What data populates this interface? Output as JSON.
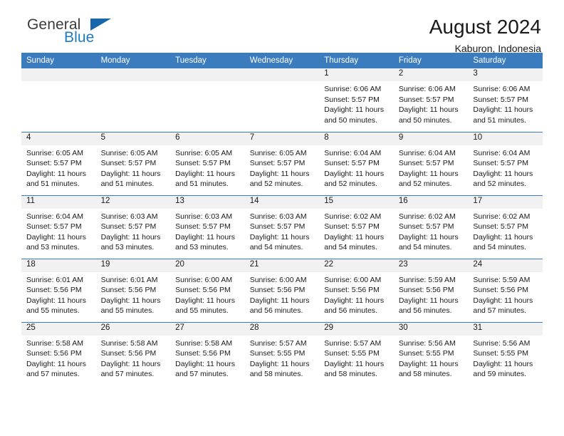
{
  "brand": {
    "name_part1": "General",
    "name_part2": "Blue",
    "flag_icon": "triangle-logo-icon"
  },
  "header": {
    "title": "August 2024",
    "location": "Kaburon, Indonesia"
  },
  "colors": {
    "header_blue": "#3a7cbe",
    "brand_blue": "#1f7bc1",
    "flag_blue": "#1866ab",
    "daynum_band": "#f1f1f1",
    "text": "#1a1a1a"
  },
  "calendar": {
    "weekday_headers": [
      "Sunday",
      "Monday",
      "Tuesday",
      "Wednesday",
      "Thursday",
      "Friday",
      "Saturday"
    ],
    "weeks": [
      [
        {
          "day": "",
          "lines": []
        },
        {
          "day": "",
          "lines": []
        },
        {
          "day": "",
          "lines": []
        },
        {
          "day": "",
          "lines": []
        },
        {
          "day": "1",
          "lines": [
            "Sunrise: 6:06 AM",
            "Sunset: 5:57 PM",
            "Daylight: 11 hours",
            "and 50 minutes."
          ]
        },
        {
          "day": "2",
          "lines": [
            "Sunrise: 6:06 AM",
            "Sunset: 5:57 PM",
            "Daylight: 11 hours",
            "and 50 minutes."
          ]
        },
        {
          "day": "3",
          "lines": [
            "Sunrise: 6:06 AM",
            "Sunset: 5:57 PM",
            "Daylight: 11 hours",
            "and 51 minutes."
          ]
        }
      ],
      [
        {
          "day": "4",
          "lines": [
            "Sunrise: 6:05 AM",
            "Sunset: 5:57 PM",
            "Daylight: 11 hours",
            "and 51 minutes."
          ]
        },
        {
          "day": "5",
          "lines": [
            "Sunrise: 6:05 AM",
            "Sunset: 5:57 PM",
            "Daylight: 11 hours",
            "and 51 minutes."
          ]
        },
        {
          "day": "6",
          "lines": [
            "Sunrise: 6:05 AM",
            "Sunset: 5:57 PM",
            "Daylight: 11 hours",
            "and 51 minutes."
          ]
        },
        {
          "day": "7",
          "lines": [
            "Sunrise: 6:05 AM",
            "Sunset: 5:57 PM",
            "Daylight: 11 hours",
            "and 52 minutes."
          ]
        },
        {
          "day": "8",
          "lines": [
            "Sunrise: 6:04 AM",
            "Sunset: 5:57 PM",
            "Daylight: 11 hours",
            "and 52 minutes."
          ]
        },
        {
          "day": "9",
          "lines": [
            "Sunrise: 6:04 AM",
            "Sunset: 5:57 PM",
            "Daylight: 11 hours",
            "and 52 minutes."
          ]
        },
        {
          "day": "10",
          "lines": [
            "Sunrise: 6:04 AM",
            "Sunset: 5:57 PM",
            "Daylight: 11 hours",
            "and 52 minutes."
          ]
        }
      ],
      [
        {
          "day": "11",
          "lines": [
            "Sunrise: 6:04 AM",
            "Sunset: 5:57 PM",
            "Daylight: 11 hours",
            "and 53 minutes."
          ]
        },
        {
          "day": "12",
          "lines": [
            "Sunrise: 6:03 AM",
            "Sunset: 5:57 PM",
            "Daylight: 11 hours",
            "and 53 minutes."
          ]
        },
        {
          "day": "13",
          "lines": [
            "Sunrise: 6:03 AM",
            "Sunset: 5:57 PM",
            "Daylight: 11 hours",
            "and 53 minutes."
          ]
        },
        {
          "day": "14",
          "lines": [
            "Sunrise: 6:03 AM",
            "Sunset: 5:57 PM",
            "Daylight: 11 hours",
            "and 54 minutes."
          ]
        },
        {
          "day": "15",
          "lines": [
            "Sunrise: 6:02 AM",
            "Sunset: 5:57 PM",
            "Daylight: 11 hours",
            "and 54 minutes."
          ]
        },
        {
          "day": "16",
          "lines": [
            "Sunrise: 6:02 AM",
            "Sunset: 5:57 PM",
            "Daylight: 11 hours",
            "and 54 minutes."
          ]
        },
        {
          "day": "17",
          "lines": [
            "Sunrise: 6:02 AM",
            "Sunset: 5:57 PM",
            "Daylight: 11 hours",
            "and 54 minutes."
          ]
        }
      ],
      [
        {
          "day": "18",
          "lines": [
            "Sunrise: 6:01 AM",
            "Sunset: 5:56 PM",
            "Daylight: 11 hours",
            "and 55 minutes."
          ]
        },
        {
          "day": "19",
          "lines": [
            "Sunrise: 6:01 AM",
            "Sunset: 5:56 PM",
            "Daylight: 11 hours",
            "and 55 minutes."
          ]
        },
        {
          "day": "20",
          "lines": [
            "Sunrise: 6:00 AM",
            "Sunset: 5:56 PM",
            "Daylight: 11 hours",
            "and 55 minutes."
          ]
        },
        {
          "day": "21",
          "lines": [
            "Sunrise: 6:00 AM",
            "Sunset: 5:56 PM",
            "Daylight: 11 hours",
            "and 56 minutes."
          ]
        },
        {
          "day": "22",
          "lines": [
            "Sunrise: 6:00 AM",
            "Sunset: 5:56 PM",
            "Daylight: 11 hours",
            "and 56 minutes."
          ]
        },
        {
          "day": "23",
          "lines": [
            "Sunrise: 5:59 AM",
            "Sunset: 5:56 PM",
            "Daylight: 11 hours",
            "and 56 minutes."
          ]
        },
        {
          "day": "24",
          "lines": [
            "Sunrise: 5:59 AM",
            "Sunset: 5:56 PM",
            "Daylight: 11 hours",
            "and 57 minutes."
          ]
        }
      ],
      [
        {
          "day": "25",
          "lines": [
            "Sunrise: 5:58 AM",
            "Sunset: 5:56 PM",
            "Daylight: 11 hours",
            "and 57 minutes."
          ]
        },
        {
          "day": "26",
          "lines": [
            "Sunrise: 5:58 AM",
            "Sunset: 5:56 PM",
            "Daylight: 11 hours",
            "and 57 minutes."
          ]
        },
        {
          "day": "27",
          "lines": [
            "Sunrise: 5:58 AM",
            "Sunset: 5:56 PM",
            "Daylight: 11 hours",
            "and 57 minutes."
          ]
        },
        {
          "day": "28",
          "lines": [
            "Sunrise: 5:57 AM",
            "Sunset: 5:55 PM",
            "Daylight: 11 hours",
            "and 58 minutes."
          ]
        },
        {
          "day": "29",
          "lines": [
            "Sunrise: 5:57 AM",
            "Sunset: 5:55 PM",
            "Daylight: 11 hours",
            "and 58 minutes."
          ]
        },
        {
          "day": "30",
          "lines": [
            "Sunrise: 5:56 AM",
            "Sunset: 5:55 PM",
            "Daylight: 11 hours",
            "and 58 minutes."
          ]
        },
        {
          "day": "31",
          "lines": [
            "Sunrise: 5:56 AM",
            "Sunset: 5:55 PM",
            "Daylight: 11 hours",
            "and 59 minutes."
          ]
        }
      ]
    ]
  }
}
